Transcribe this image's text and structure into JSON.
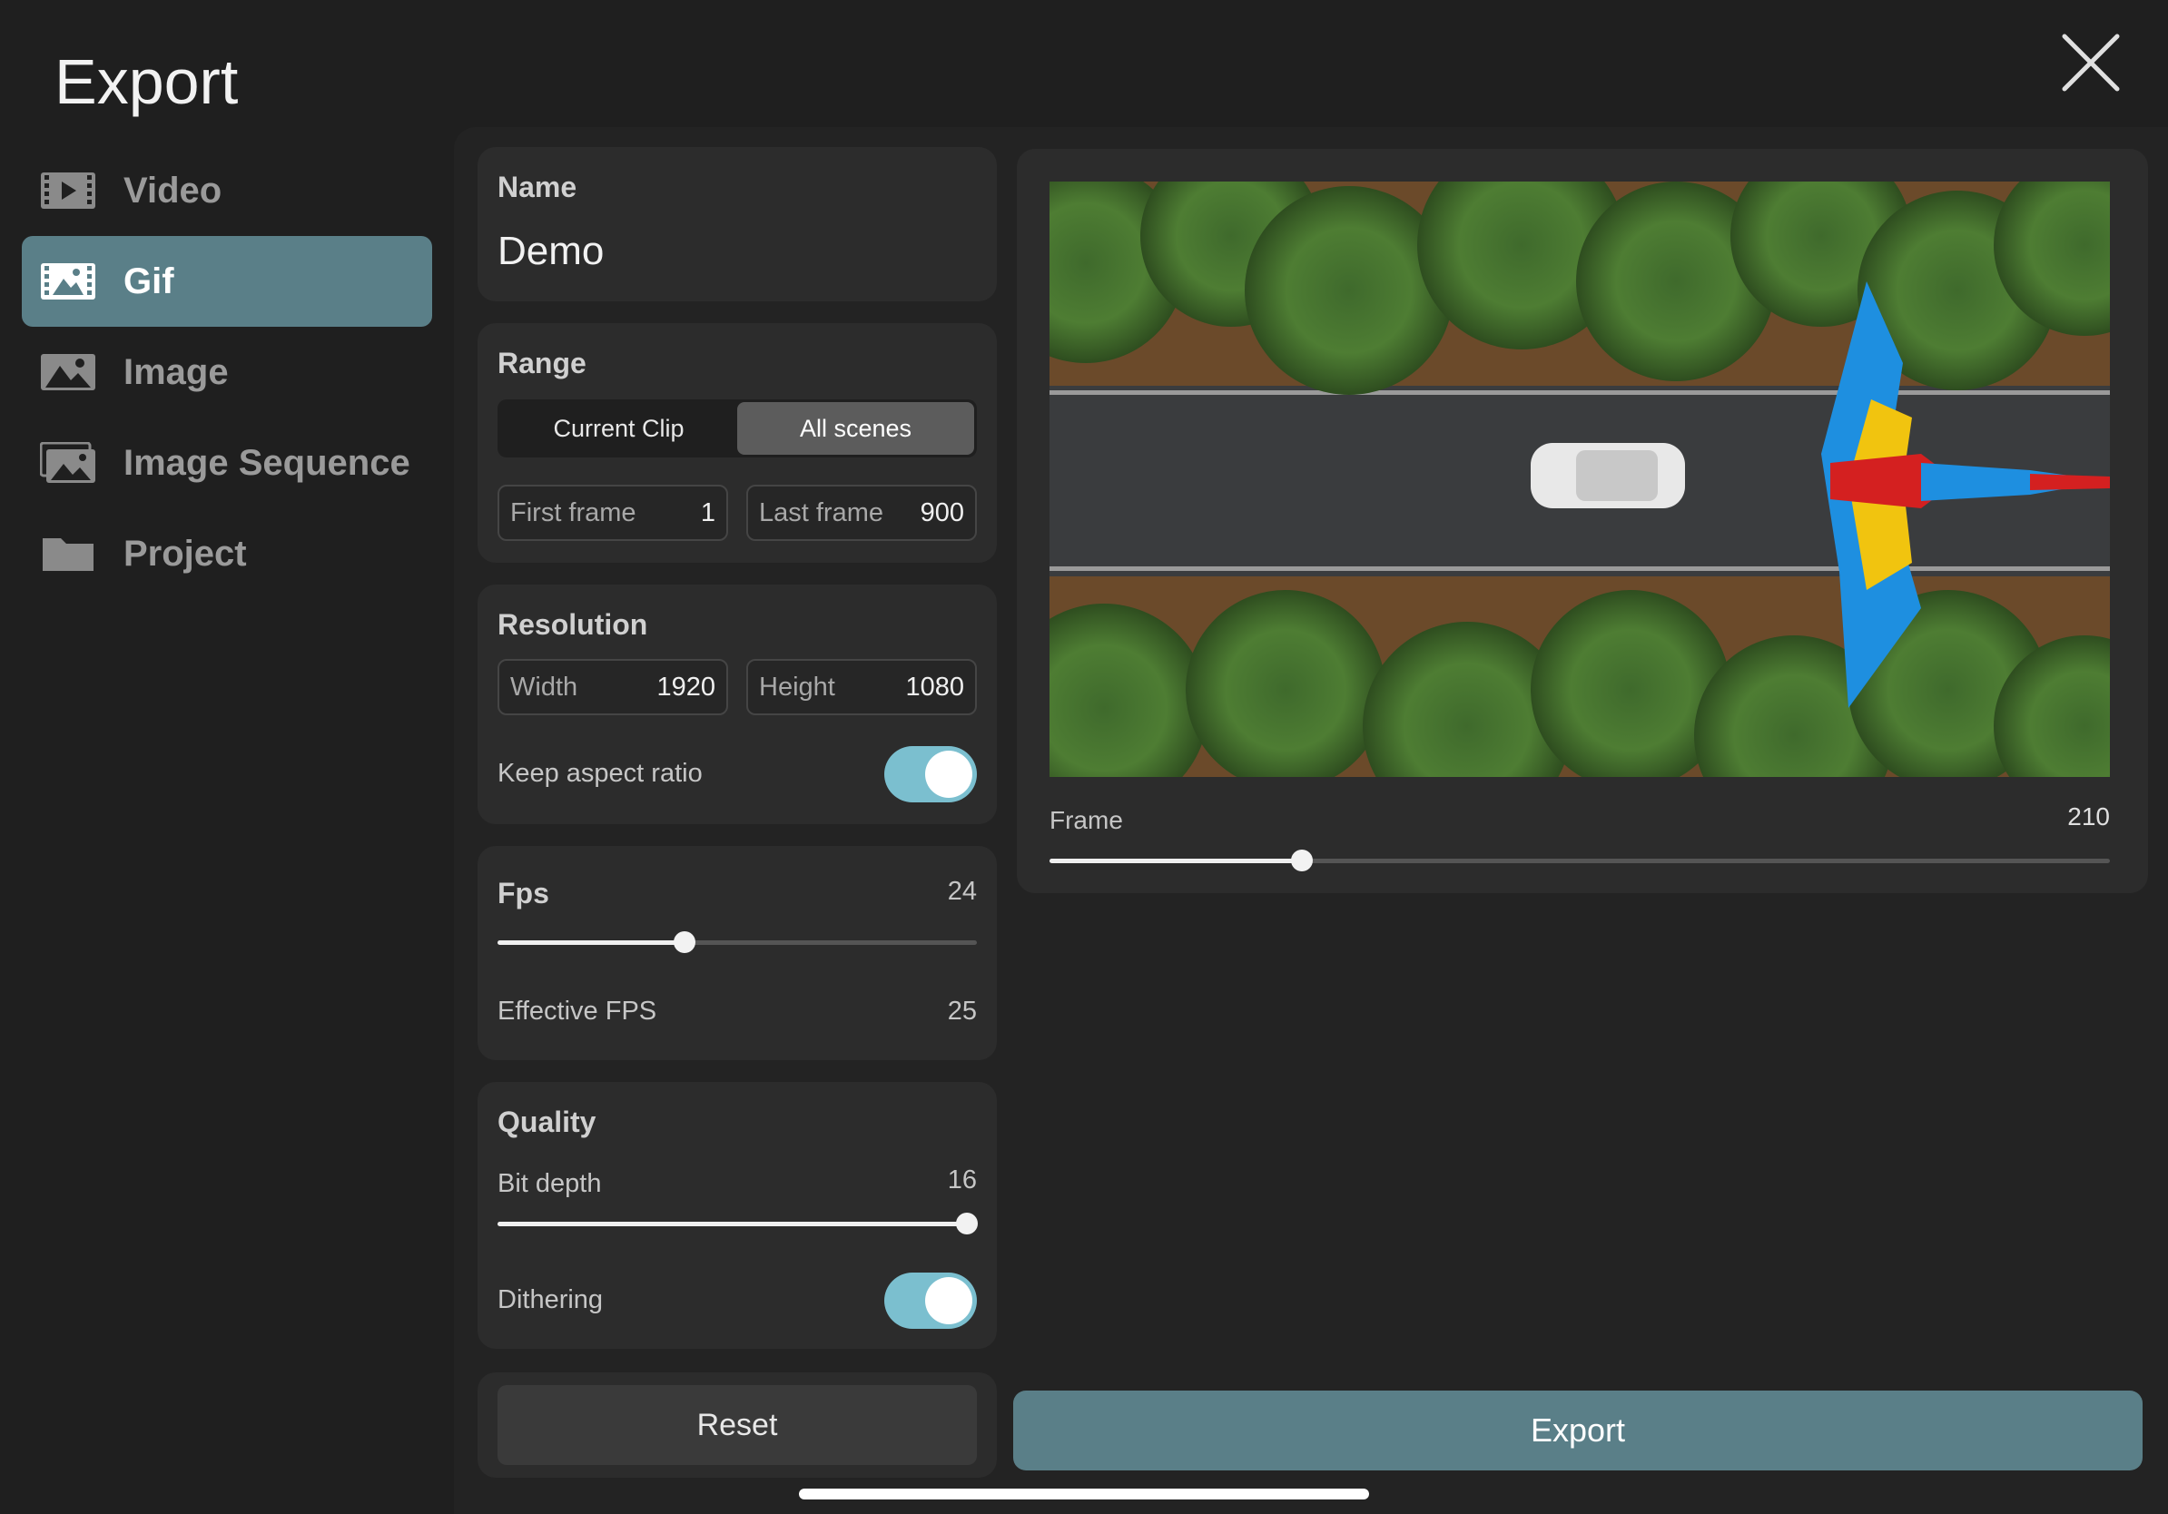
{
  "header": {
    "title": "Export"
  },
  "sidebar": {
    "items": [
      {
        "label": "Video",
        "icon": "film-icon",
        "active": false
      },
      {
        "label": "Gif",
        "icon": "gif-image-icon",
        "active": true
      },
      {
        "label": "Image",
        "icon": "image-icon",
        "active": false
      },
      {
        "label": "Image Sequence",
        "icon": "image-stack-icon",
        "active": false
      },
      {
        "label": "Project",
        "icon": "folder-icon",
        "active": false
      }
    ]
  },
  "name_section": {
    "title": "Name",
    "value": "Demo"
  },
  "range_section": {
    "title": "Range",
    "segments": [
      "Current Clip",
      "All scenes"
    ],
    "selected": "All scenes",
    "first_frame_label": "First frame",
    "first_frame_value": "1",
    "last_frame_label": "Last frame",
    "last_frame_value": "900"
  },
  "resolution_section": {
    "title": "Resolution",
    "width_label": "Width",
    "width_value": "1920",
    "height_label": "Height",
    "height_value": "1080",
    "aspect_label": "Keep aspect ratio",
    "aspect_on": true
  },
  "fps_section": {
    "title": "Fps",
    "value": "24",
    "slider_fraction": 0.39,
    "effective_label": "Effective FPS",
    "effective_value": "25"
  },
  "quality_section": {
    "title": "Quality",
    "bit_depth_label": "Bit depth",
    "bit_depth_value": "16",
    "bit_depth_fraction": 0.98,
    "dithering_label": "Dithering",
    "dithering_on": true
  },
  "actions": {
    "reset_label": "Reset",
    "export_label": "Export"
  },
  "preview": {
    "frame_label": "Frame",
    "frame_value": "210",
    "frame_fraction": 0.238
  },
  "colors": {
    "accent": "#5a7f88",
    "toggle_on": "#7bbfcf",
    "background": "#1f1f1f",
    "card": "#2c2c2c"
  }
}
